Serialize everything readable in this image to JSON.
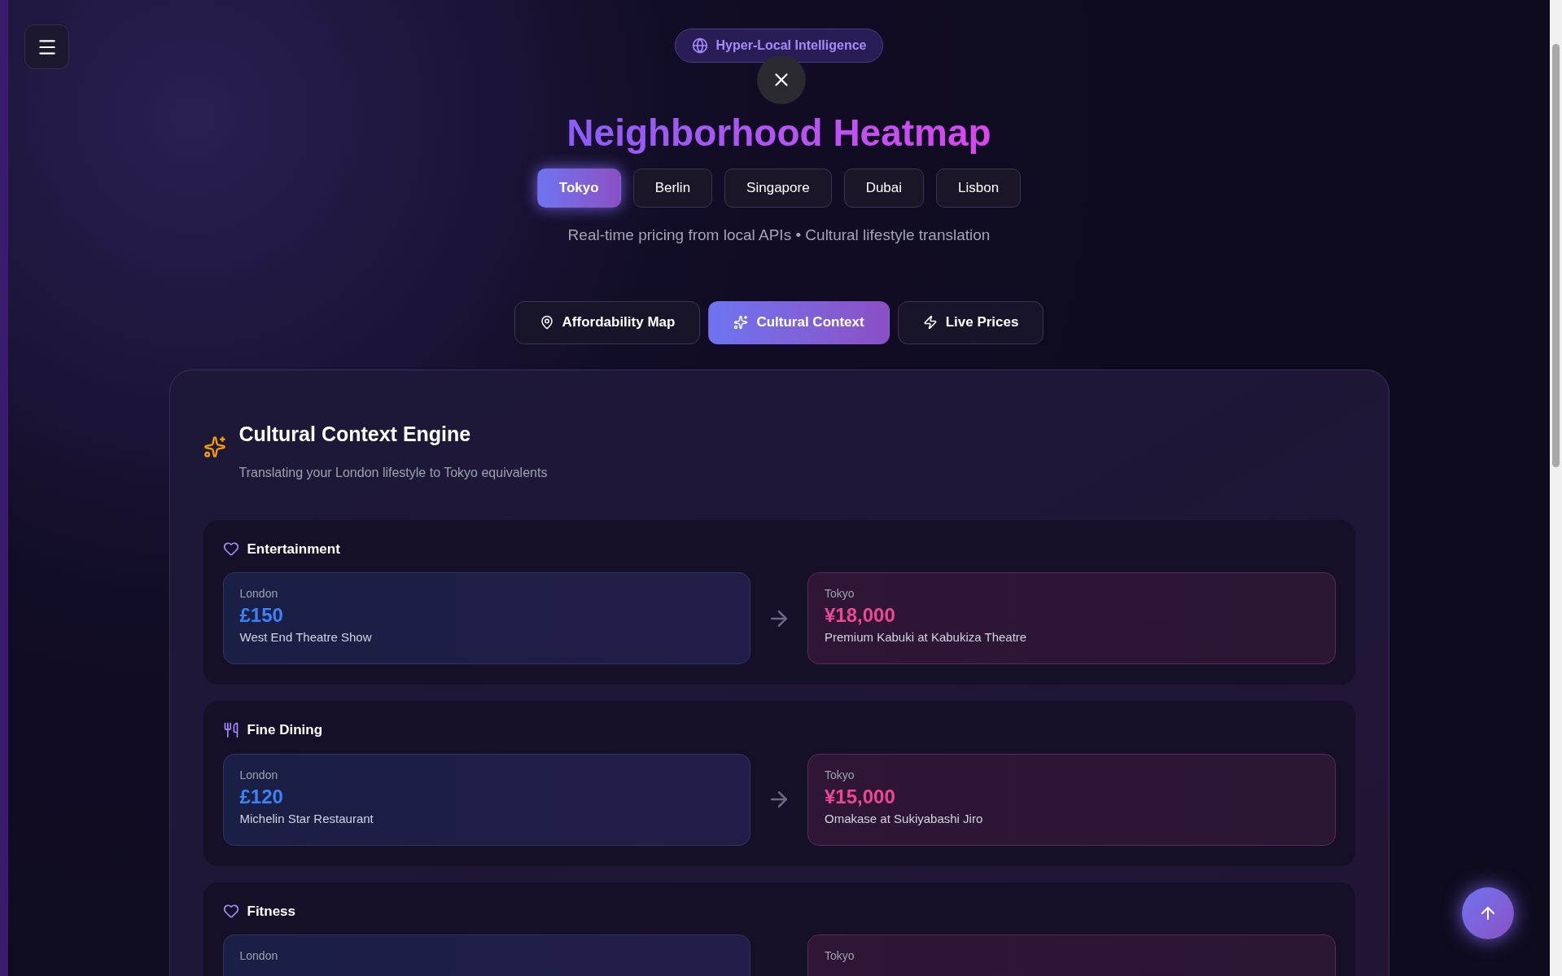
{
  "badge": "Hyper-Local Intelligence",
  "title": "Neighborhood Heatmap",
  "cities": [
    {
      "label": "Tokyo",
      "selected": true
    },
    {
      "label": "Berlin",
      "selected": false
    },
    {
      "label": "Singapore",
      "selected": false
    },
    {
      "label": "Dubai",
      "selected": false
    },
    {
      "label": "Lisbon",
      "selected": false
    }
  ],
  "subtitle": "Real-time pricing from local APIs • Cultural lifestyle translation",
  "views": [
    {
      "label": "Affordability Map",
      "kind": "map",
      "selected": false
    },
    {
      "label": "Cultural Context",
      "kind": "sparkles",
      "selected": true
    },
    {
      "label": "Live Prices",
      "kind": "zap",
      "selected": false
    }
  ],
  "panel": {
    "title": "Cultural Context Engine",
    "description": "Translating your London lifestyle to Tokyo equivalents",
    "categories": [
      {
        "name": "Entertainment",
        "kind": "heart",
        "home": {
          "city": "London",
          "price": "£150",
          "item": "West End Theatre Show"
        },
        "local": {
          "city": "Tokyo",
          "price": "¥18,000",
          "item": "Premium Kabuki at Kabukiza Theatre"
        }
      },
      {
        "name": "Fine Dining",
        "kind": "dining",
        "home": {
          "city": "London",
          "price": "£120",
          "item": "Michelin Star Restaurant"
        },
        "local": {
          "city": "Tokyo",
          "price": "¥15,000",
          "item": "Omakase at Sukiyabashi Jiro"
        }
      },
      {
        "name": "Fitness",
        "kind": "heart",
        "home": {
          "city": "London"
        },
        "local": {
          "city": "Tokyo"
        }
      }
    ]
  }
}
